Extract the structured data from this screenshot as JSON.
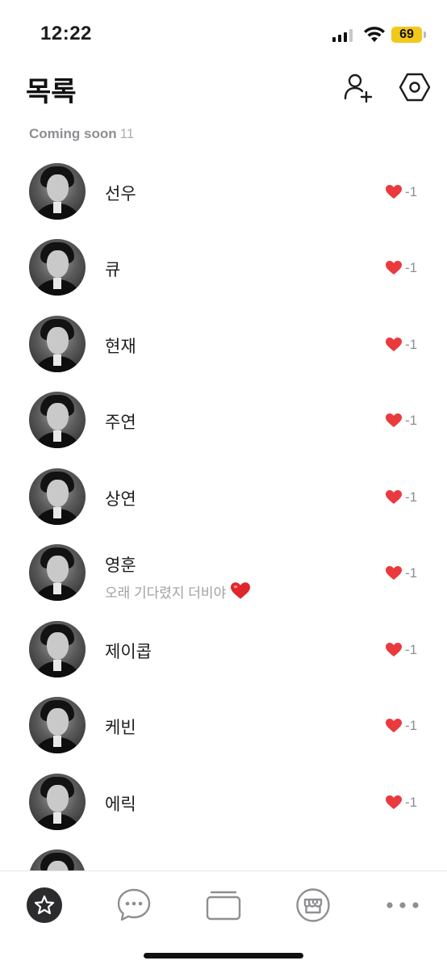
{
  "status_bar": {
    "time": "12:22",
    "battery": "69",
    "battery_color": "#f2c81b"
  },
  "header": {
    "title": "목록",
    "add_friend_icon": "person-add-icon",
    "settings_icon": "hexagon-settings-icon"
  },
  "section": {
    "title": "Coming soon",
    "count": "11"
  },
  "friends": [
    {
      "name": "선우",
      "status": "",
      "likes": "-1"
    },
    {
      "name": "큐",
      "status": "",
      "likes": "-1"
    },
    {
      "name": "현재",
      "status": "",
      "likes": "-1"
    },
    {
      "name": "주연",
      "status": "",
      "likes": "-1"
    },
    {
      "name": "상연",
      "status": "",
      "likes": "-1"
    },
    {
      "name": "영훈",
      "status": "오래 기다렸지 더비야",
      "likes": "-1"
    },
    {
      "name": "제이콥",
      "status": "",
      "likes": "-1"
    },
    {
      "name": "케빈",
      "status": "",
      "likes": "-1"
    },
    {
      "name": "에릭",
      "status": "",
      "likes": "-1"
    },
    {
      "name": "",
      "status": "",
      "likes": ""
    }
  ],
  "heart_color": "#ea3a3d",
  "tabs": [
    {
      "id": "friends",
      "icon": "star-icon",
      "active": true
    },
    {
      "id": "chats",
      "icon": "chat-bubble-icon",
      "active": false
    },
    {
      "id": "view",
      "icon": "cards-icon",
      "active": false
    },
    {
      "id": "shopping",
      "icon": "shop-icon",
      "active": false
    },
    {
      "id": "more",
      "icon": "more-dots-icon",
      "active": false
    }
  ]
}
